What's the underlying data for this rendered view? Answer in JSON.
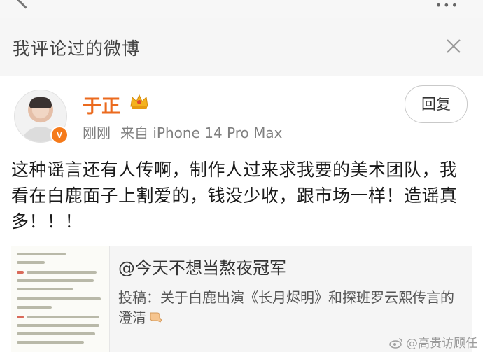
{
  "colors": {
    "username": "#eb6a1e",
    "badge": "#f57a1a",
    "header_bg": "#f6f6f6"
  },
  "header": {
    "title": "我评论过的微博",
    "close_icon": "close-icon"
  },
  "post": {
    "author": "于正",
    "meta": {
      "time": "刚刚",
      "source": "来自 iPhone 14 Pro Max"
    },
    "reply_label": "回复",
    "text": "这种谣言还有人传啊，制作人过来求我要的美术团队，我看在白鹿面子上割爱的，钱没少收，跟市场一样！造谣真多！！！"
  },
  "quote": {
    "author": "@今天不想当熬夜冠军",
    "text": "投稿：关于白鹿出演《长月烬明》和探班罗云熙传言的澄清"
  },
  "watermark": "@高贵访顾任"
}
